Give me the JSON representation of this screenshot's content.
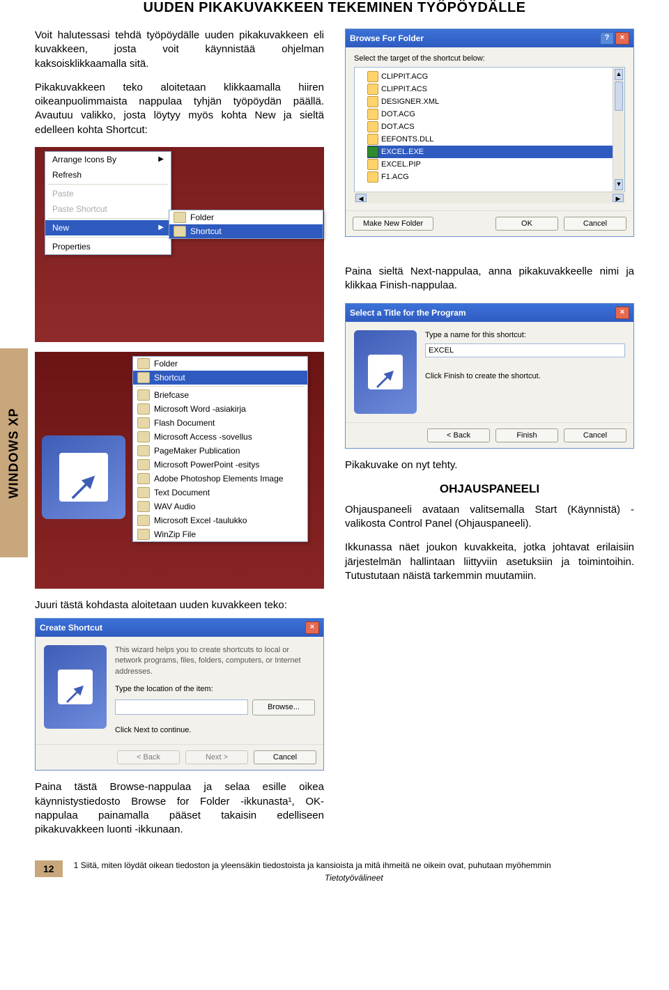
{
  "title": "UUDEN PIKAKUVAKKEEN TEKEMINEN TYÖPÖYDÄLLE",
  "sidetab": "WINDOWS XP",
  "para1": "Voit halutessasi tehdä työpöydälle uuden pikakuvakkeen eli kuvakkeen, josta voit käynnistää ohjelman kaksoisklikkaamalla sitä.",
  "para2": "Pikakuvakkeen teko aloitetaan klikkaamalla hiiren oikeanpuolimmaista nappulaa tyhjän työpöydän päällä. Avautuu valikko, josta löytyy myös kohta New ja sieltä edelleen kohta Shortcut:",
  "browseFolder": {
    "title": "Browse For Folder",
    "label": "Select the target of the shortcut below:",
    "items": [
      "CLIPPIT.ACG",
      "CLIPPIT.ACS",
      "DESIGNER.XML",
      "DOT.ACG",
      "DOT.ACS",
      "EEFONTS.DLL",
      "EXCEL.EXE",
      "EXCEL.PIP",
      "F1.ACG"
    ],
    "selectedIndex": 6,
    "makeNew": "Make New Folder",
    "ok": "OK",
    "cancel": "Cancel"
  },
  "ctx": {
    "arrange": "Arrange Icons By",
    "refresh": "Refresh",
    "paste": "Paste",
    "pasteShortcut": "Paste Shortcut",
    "new": "New",
    "properties": "Properties",
    "folder": "Folder",
    "shortcut": "Shortcut"
  },
  "newTypes": [
    "Briefcase",
    "Microsoft Word -asiakirja",
    "Flash Document",
    "Microsoft Access -sovellus",
    "PageMaker Publication",
    "Microsoft PowerPoint -esitys",
    "Adobe Photoshop Elements Image",
    "Text Document",
    "WAV Audio",
    "Microsoft Excel -taulukko",
    "WinZip File"
  ],
  "para3": "Paina sieltä Next-nappulaa, anna pikakuvakkeelle nimi ja klikkaa Finish-nappulaa.",
  "caption1": "Juuri tästä kohdasta aloitetaan uuden kuvakkeen teko:",
  "titleDlg": {
    "title": "Select a Title for the Program",
    "label": "Type a name for this shortcut:",
    "value": "EXCEL",
    "hint": "Click Finish to create the shortcut.",
    "back": "< Back",
    "finish": "Finish",
    "cancel": "Cancel"
  },
  "wizard": {
    "title": "Create Shortcut",
    "desc": "This wizard helps you to create shortcuts to local or network programs, files, folders, computers, or Internet addresses.",
    "label": "Type the location of the item:",
    "browse": "Browse...",
    "hint": "Click Next to continue.",
    "back": "< Back",
    "next": "Next >",
    "cancel": "Cancel"
  },
  "para4": "Pikakuvake on nyt tehty.",
  "heading2": "OHJAUSPANEELI",
  "para5": "Paina tästä Browse-nappulaa ja selaa esille oikea käynnistystiedosto Browse for Folder -ikkunasta¹, OK-nappulaa painamalla pääset takaisin edelliseen pikakuvakkeen luonti -ikkunaan.",
  "para6": "Ohjauspaneeli avataan valitsemalla Start (Käynnistä) -valikosta Control Panel (Ohjauspaneeli).",
  "para7": "Ikkunassa näet joukon kuvakkeita, jotka johtavat erilaisiin järjestelmän hallintaan liittyviin asetuksiin ja toimintoihin. Tutustutaan näistä tarkemmin muutamiin.",
  "pageNum": "12",
  "footnote": "1 Siitä, miten löydät oikean tiedoston ja yleensäkin tiedostoista ja kansioista ja mitä ihmeitä ne oikein ovat, puhutaan myöhemmin",
  "footCenter": "Tietotyövälineet"
}
